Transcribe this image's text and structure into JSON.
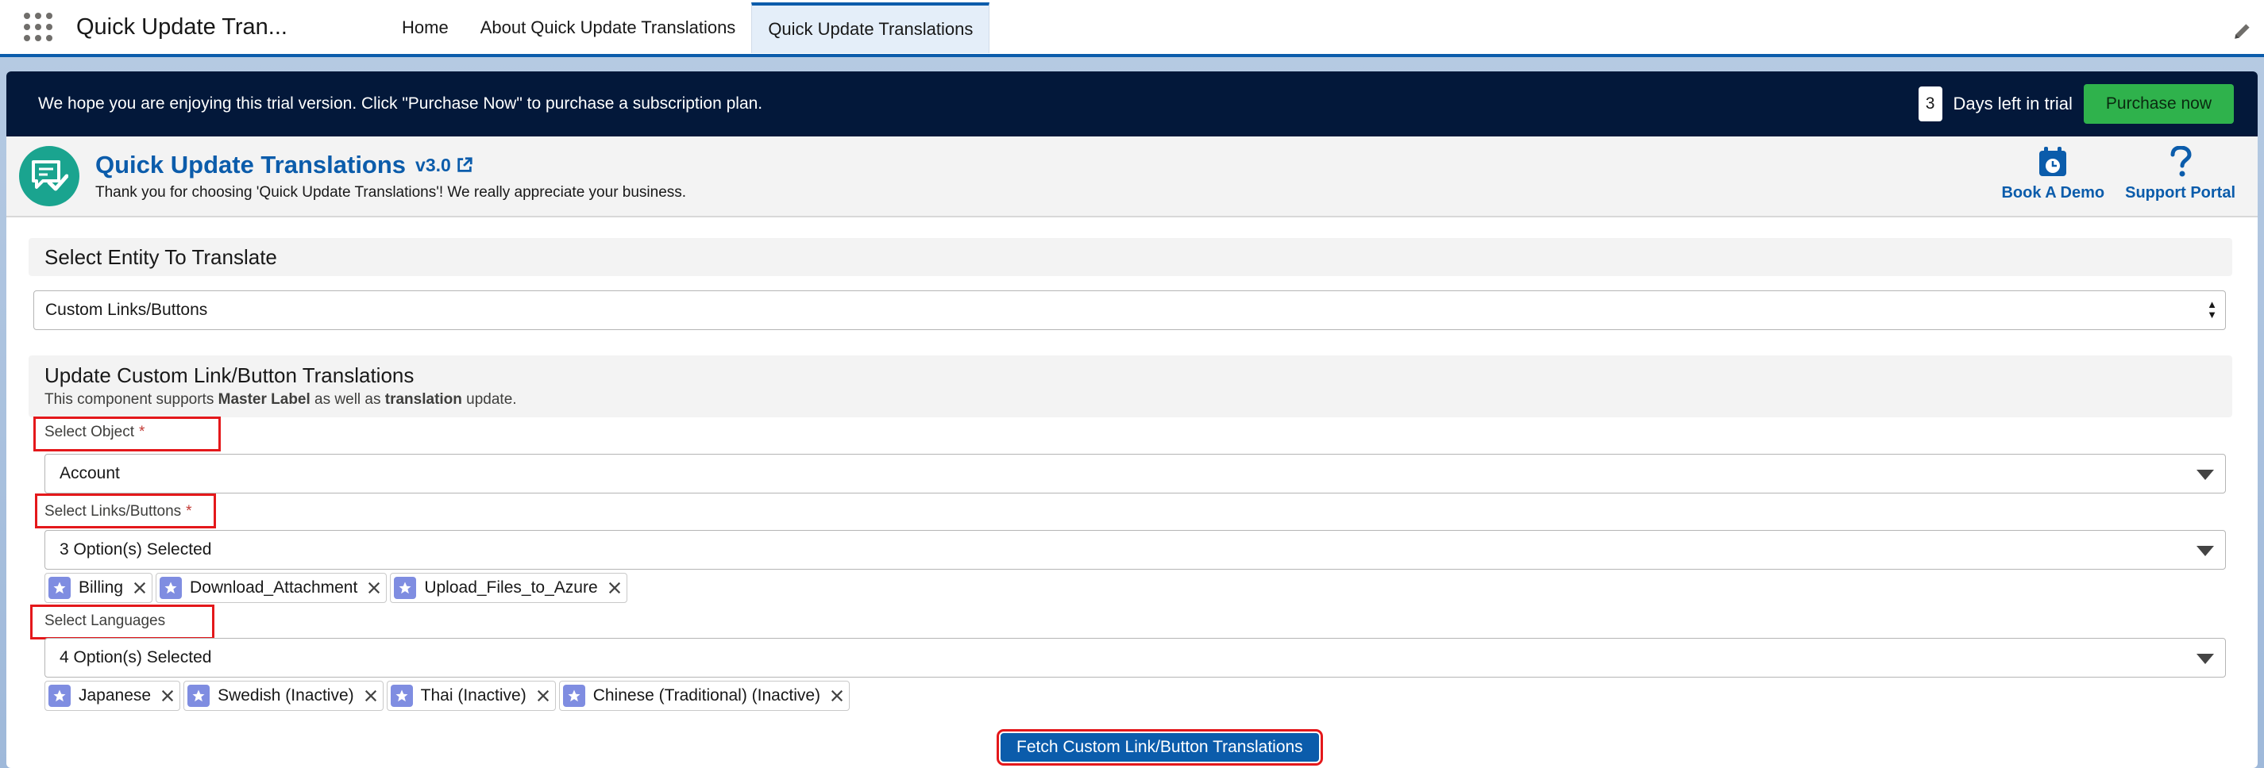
{
  "nav": {
    "app_name": "Quick Update Tran...",
    "tabs": [
      {
        "label": "Home"
      },
      {
        "label": "About Quick Update Translations"
      },
      {
        "label": "Quick Update Translations"
      }
    ]
  },
  "trial_banner": {
    "message": "We hope you are enjoying this trial version. Click \"Purchase Now\" to purchase a subscription plan.",
    "days_left": "3",
    "days_text": "Days left in trial",
    "purchase_label": "Purchase now"
  },
  "app_header": {
    "title": "Quick Update Translations",
    "version": "v3.0",
    "subtitle": "Thank you for choosing 'Quick Update Translations'! We really appreciate your business.",
    "actions": [
      {
        "label": "Book A Demo",
        "icon": "calendar-clock-icon"
      },
      {
        "label": "Support Portal",
        "icon": "question-icon"
      }
    ]
  },
  "entity": {
    "heading": "Select Entity To Translate",
    "selected": "Custom Links/Buttons"
  },
  "update": {
    "heading": "Update Custom Link/Button Translations",
    "desc_prefix": "This component supports ",
    "desc_bold1": "Master Label",
    "desc_mid": " as well as ",
    "desc_bold2": "translation",
    "desc_suffix": " update."
  },
  "fields": {
    "object": {
      "label": "Select Object",
      "required": "*",
      "value": "Account"
    },
    "links": {
      "label": "Select Links/Buttons",
      "required": "*",
      "value": "3 Option(s) Selected",
      "pills": [
        "Billing",
        "Download_Attachment",
        "Upload_Files_to_Azure"
      ]
    },
    "languages": {
      "label": "Select Languages",
      "value": "4 Option(s) Selected",
      "pills": [
        "Japanese",
        "Swedish (Inactive)",
        "Thai (Inactive)",
        "Chinese (Traditional) (Inactive)"
      ]
    }
  },
  "fetch_button": "Fetch Custom Link/Button Translations",
  "colors": {
    "brand": "#0b5cab",
    "banner": "#03183a",
    "purchase": "#2fb24c",
    "logo": "#1aa48f",
    "pill_icon": "#7f8de1",
    "highlight": "#e4181b"
  }
}
